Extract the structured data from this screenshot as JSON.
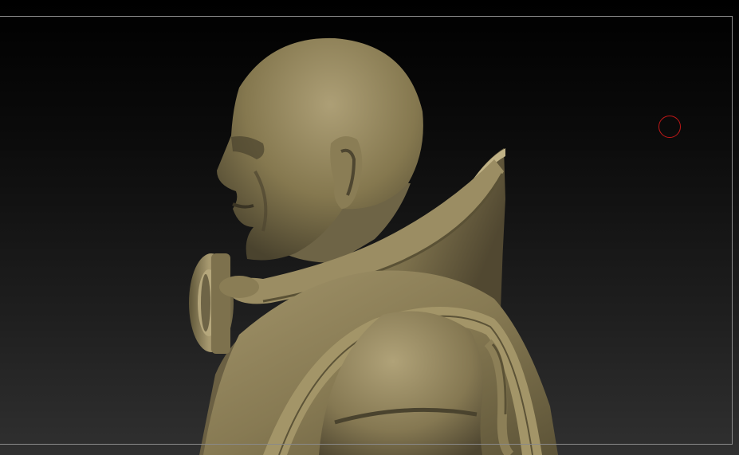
{
  "viewport": {
    "background_top": "#000000",
    "background_bottom": "#303030",
    "frame_color": "#8a8a8a"
  },
  "model": {
    "subject": "sculpted-bust-profile",
    "material_color": "#8a7d58",
    "highlight_color": "#b3a67c",
    "shadow_color": "#3a3424"
  },
  "cursor": {
    "icon": "brush-circle-icon",
    "color": "#c01818"
  }
}
